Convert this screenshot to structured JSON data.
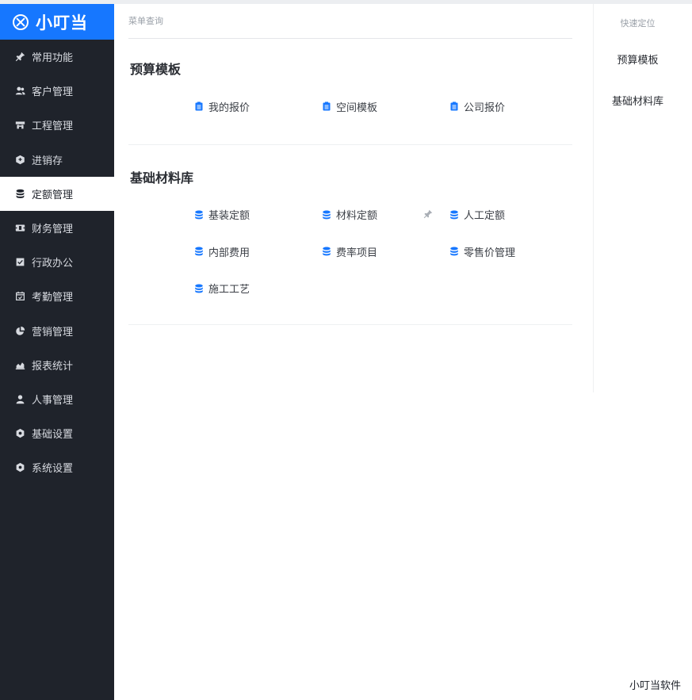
{
  "app": {
    "logo": "小叮当",
    "footer_brand": "小叮当软件"
  },
  "sidebar": {
    "items": [
      {
        "label": "常用功能",
        "icon": "pin-icon"
      },
      {
        "label": "客户管理",
        "icon": "users-icon"
      },
      {
        "label": "工程管理",
        "icon": "project-icon"
      },
      {
        "label": "进销存",
        "icon": "box-icon"
      },
      {
        "label": "定额管理",
        "icon": "database-icon",
        "active": true
      },
      {
        "label": "财务管理",
        "icon": "finance-icon"
      },
      {
        "label": "行政办公",
        "icon": "checkbox-icon"
      },
      {
        "label": "考勤管理",
        "icon": "calendar-check-icon"
      },
      {
        "label": "营销管理",
        "icon": "chart-pie-icon"
      },
      {
        "label": "报表统计",
        "icon": "area-chart-icon"
      },
      {
        "label": "人事管理",
        "icon": "person-icon"
      },
      {
        "label": "基础设置",
        "icon": "gear-icon"
      },
      {
        "label": "系统设置",
        "icon": "gear-icon"
      }
    ]
  },
  "main": {
    "breadcrumb": "菜单查询",
    "sections": [
      {
        "title": "预算模板",
        "items": [
          {
            "label": "我的报价",
            "icon": "clipboard-icon"
          },
          {
            "label": "空间模板",
            "icon": "clipboard-icon"
          },
          {
            "label": "公司报价",
            "icon": "clipboard-icon"
          }
        ]
      },
      {
        "title": "基础材料库",
        "items": [
          {
            "label": "基装定额",
            "icon": "database-icon"
          },
          {
            "label": "材料定额",
            "icon": "database-icon"
          },
          {
            "label": "人工定额",
            "icon": "database-icon",
            "pinned": true
          },
          {
            "label": "内部费用",
            "icon": "database-icon"
          },
          {
            "label": "费率项目",
            "icon": "database-icon"
          },
          {
            "label": "零售价管理",
            "icon": "database-icon"
          },
          {
            "label": "施工工艺",
            "icon": "database-icon"
          }
        ]
      }
    ]
  },
  "quick_nav": {
    "title": "快速定位",
    "items": [
      {
        "label": "预算模板"
      },
      {
        "label": "基础材料库"
      }
    ]
  },
  "colors": {
    "accent": "#1677ff",
    "sidebar_bg": "#1f232b",
    "icon_blue": "#1677ff"
  }
}
